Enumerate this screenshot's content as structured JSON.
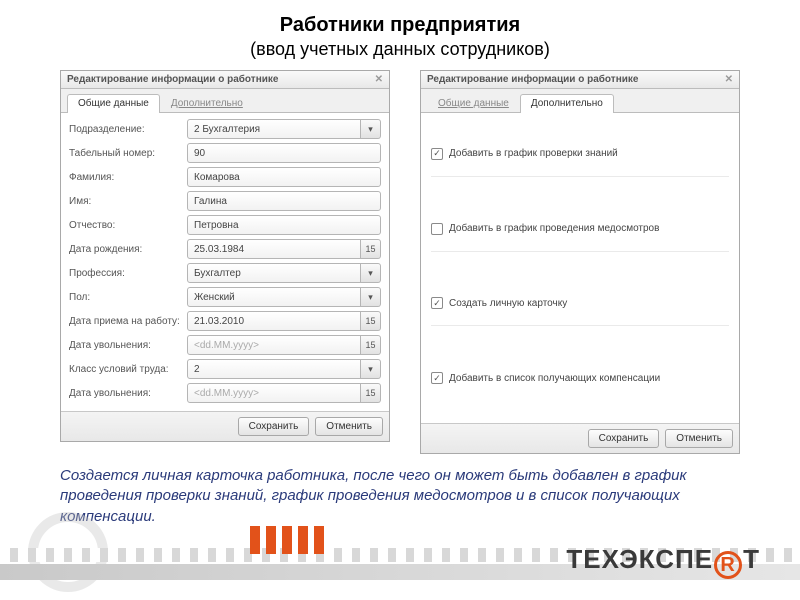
{
  "page": {
    "title": "Работники предприятия",
    "subtitle": "(ввод учетных данных сотрудников)"
  },
  "dialog": {
    "title": "Редактирование информации о работнике",
    "tabs": {
      "general": "Общие данные",
      "extra": "Дополнительно"
    },
    "buttons": {
      "save": "Сохранить",
      "cancel": "Отменить"
    }
  },
  "form": {
    "fields": {
      "department": {
        "label": "Подразделение:",
        "value": "2 Бухгалтерия"
      },
      "tabnum": {
        "label": "Табельный номер:",
        "value": "90"
      },
      "lastname": {
        "label": "Фамилия:",
        "value": "Комарова"
      },
      "firstname": {
        "label": "Имя:",
        "value": "Галина"
      },
      "patronymic": {
        "label": "Отчество:",
        "value": "Петровна"
      },
      "birthdate": {
        "label": "Дата рождения:",
        "value": "25.03.1984"
      },
      "profession": {
        "label": "Профессия:",
        "value": "Бухгалтер"
      },
      "gender": {
        "label": "Пол:",
        "value": "Женский"
      },
      "hiredate": {
        "label": "Дата приема на работу:",
        "value": "21.03.2010"
      },
      "firedate": {
        "label": "Дата увольнения:",
        "value": "",
        "placeholder": "<dd.MM.yyyy>"
      },
      "laborclass": {
        "label": "Класс условий труда:",
        "value": "2"
      },
      "firedate2": {
        "label": "Дата увольнения:",
        "value": "",
        "placeholder": "<dd.MM.yyyy>"
      }
    }
  },
  "extra": {
    "items": [
      {
        "label": "Добавить в график проверки знаний",
        "checked": true
      },
      {
        "label": "Добавить в график проведения медосмотров",
        "checked": false
      },
      {
        "label": "Создать личную карточку",
        "checked": true
      },
      {
        "label": "Добавить в список получающих компенсации",
        "checked": true
      }
    ]
  },
  "description": "Создается личная карточка работника, после чего он может быть добавлен в график проведения проверки знаний, график проведения медосмотров и в список получающих компенсации.",
  "brand": {
    "part1": "ТЕХЭКСПЕ",
    "part2": "Т",
    "registered": "R"
  },
  "icons": {
    "dropdown": "▾",
    "calendar": "15",
    "close": "✕"
  }
}
